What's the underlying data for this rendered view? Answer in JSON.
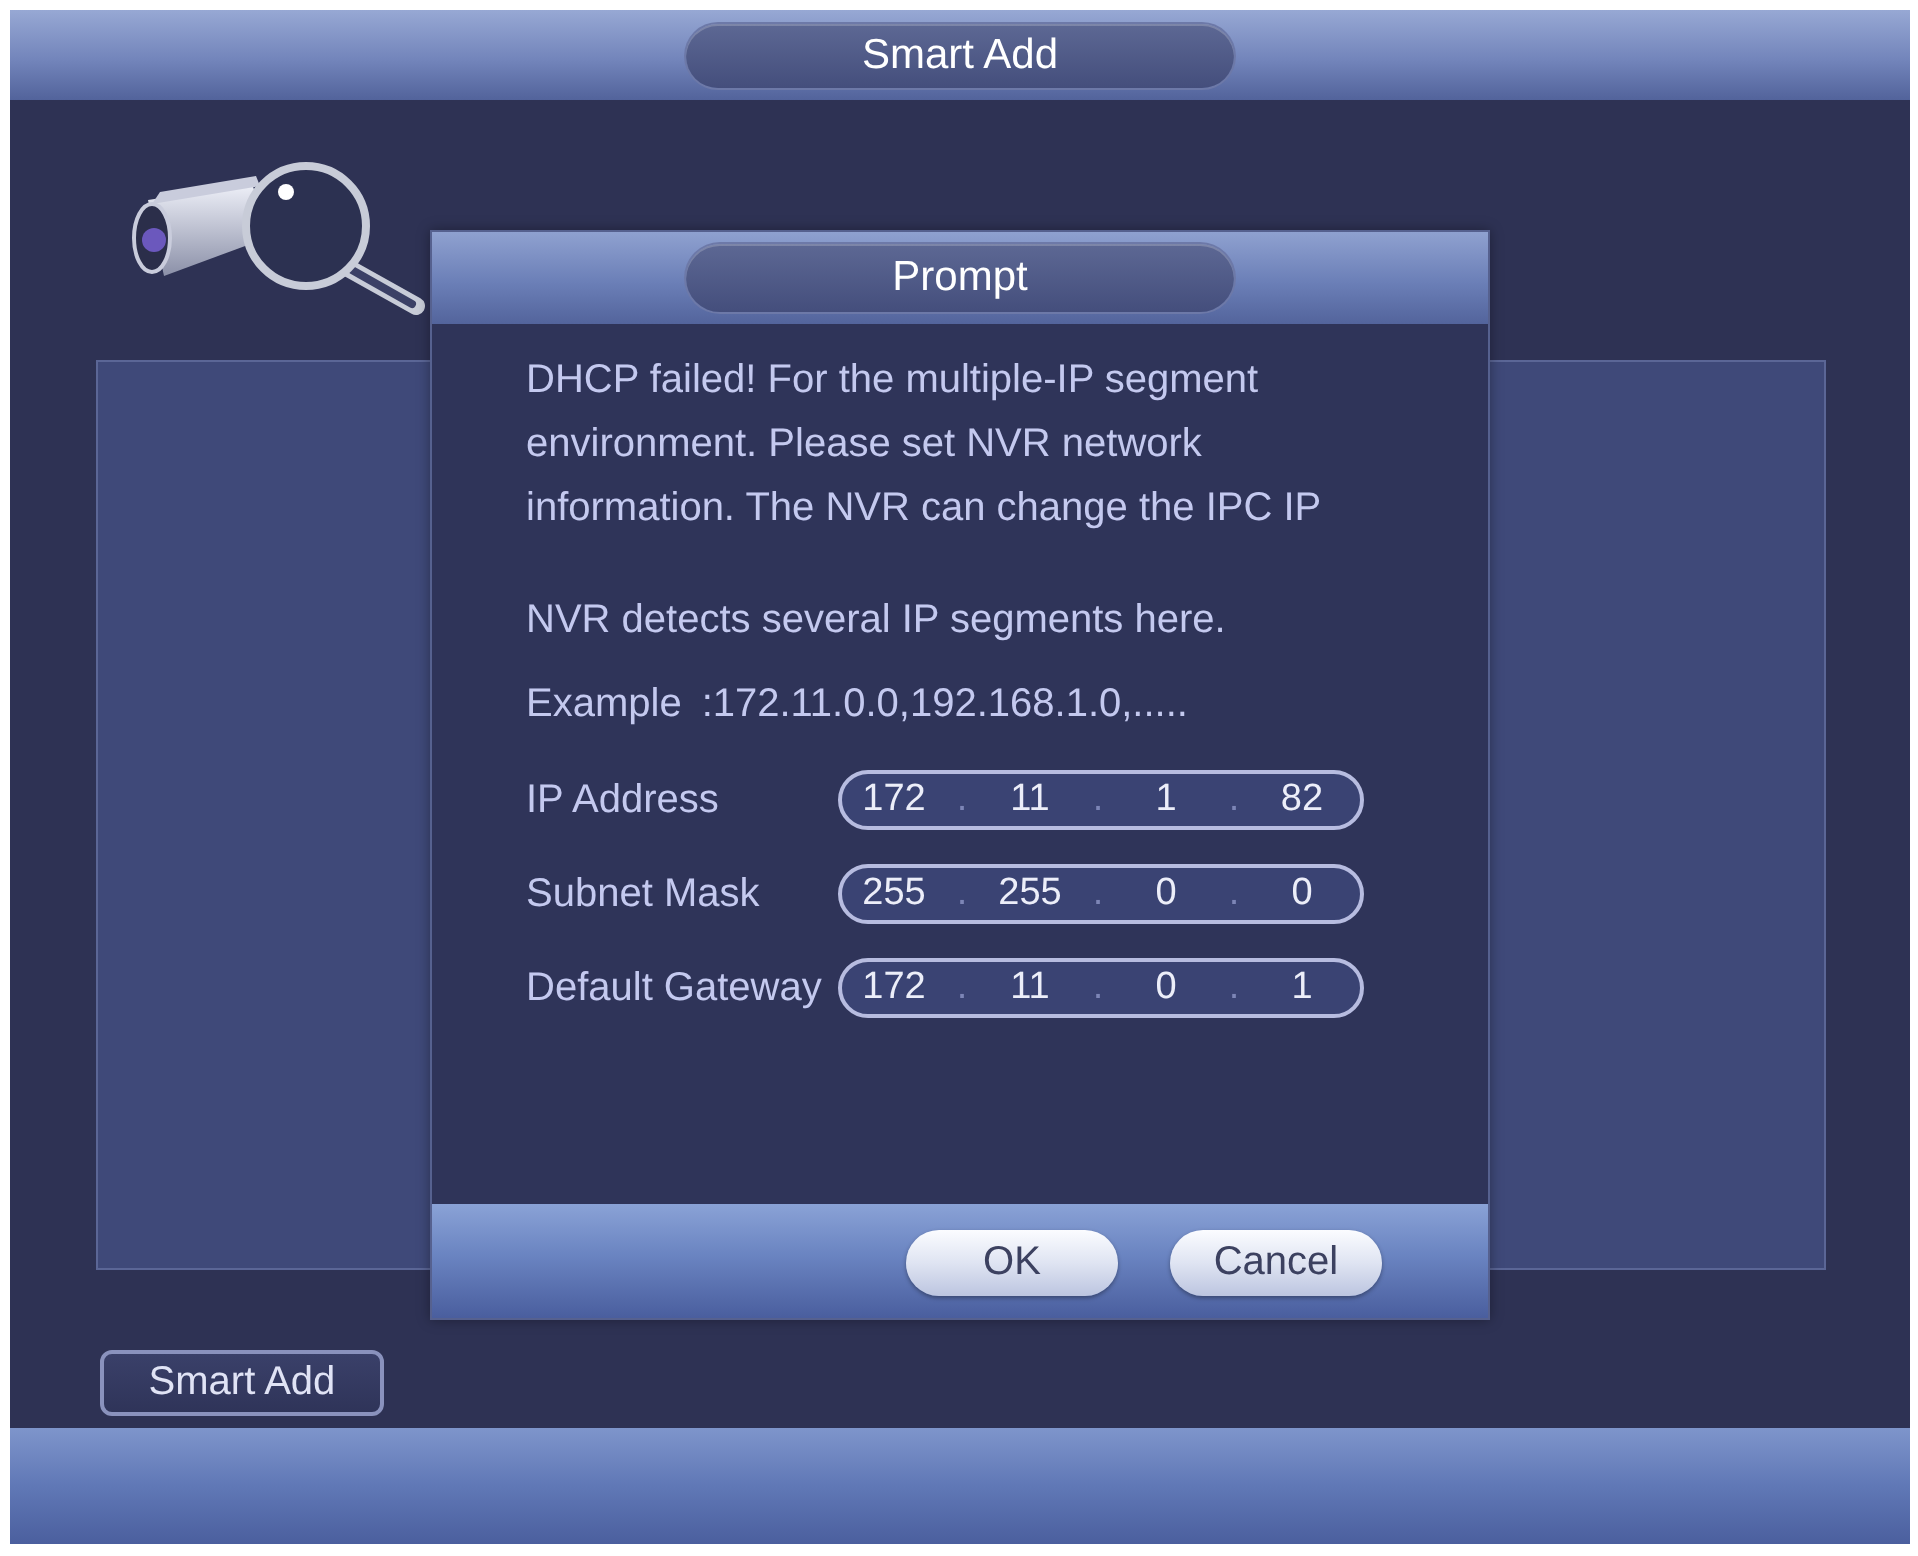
{
  "window": {
    "title": "Smart Add"
  },
  "smart_add_button": {
    "label": "Smart Add"
  },
  "dialog": {
    "title": "Prompt",
    "message": [
      "DHCP failed! For the multiple-IP segment",
      "environment. Please set NVR network",
      "information. The NVR can change the IPC IP"
    ],
    "note": "NVR detects several IP segments here.",
    "example": {
      "label": "Example",
      "value": ":172.11.0.0,192.168.1.0,....."
    },
    "fields": [
      {
        "label": "IP Address",
        "value": "172 . 11 . 1 . 82"
      },
      {
        "label": "Subnet Mask",
        "value": "255 . 255 . 0 . 0"
      },
      {
        "label": "Default Gateway",
        "value": "172 . 11 . 0 . 1"
      }
    ],
    "buttons": [
      {
        "label": "OK"
      },
      {
        "label": "Cancel"
      }
    ]
  }
}
